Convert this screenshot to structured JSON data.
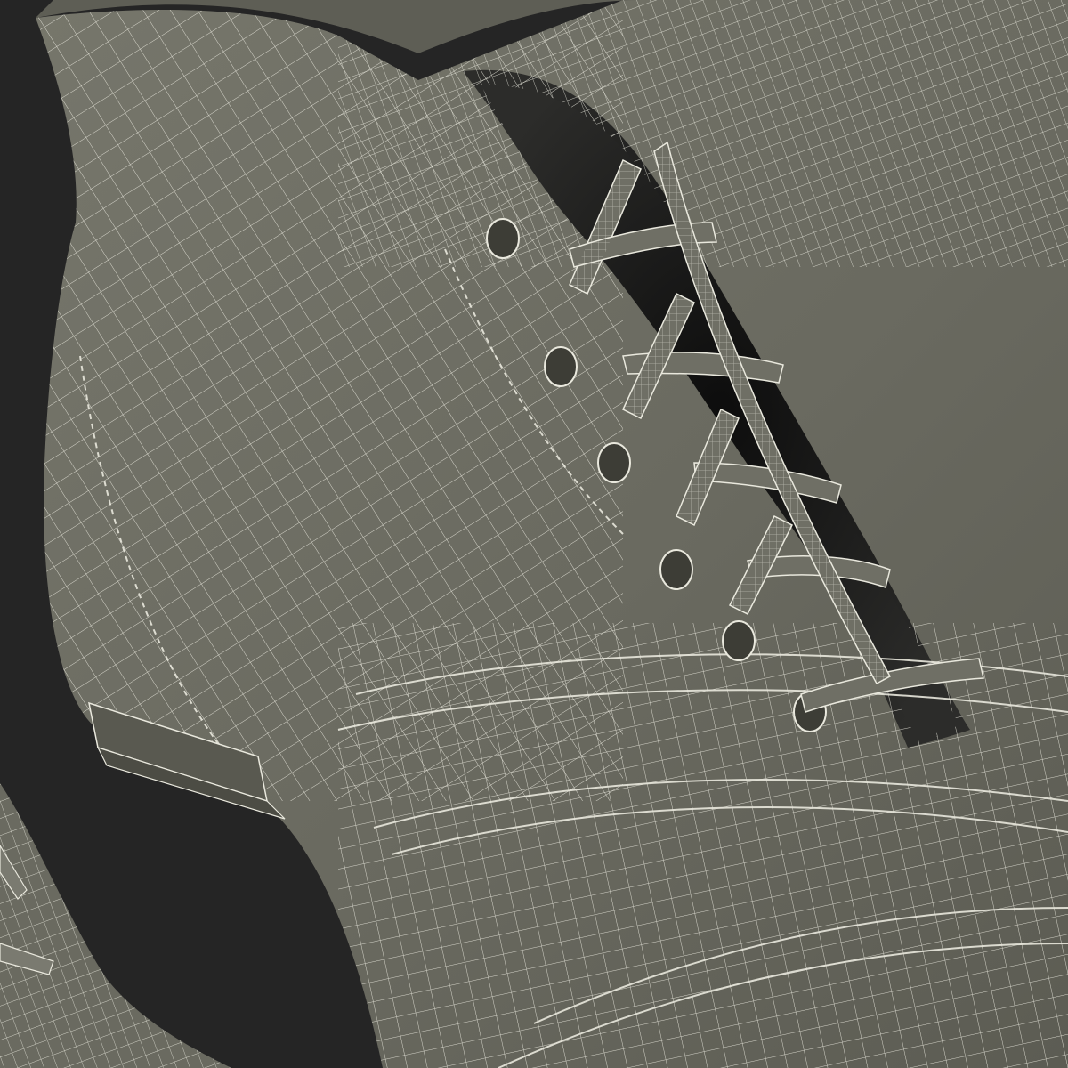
{
  "scene": {
    "subject": "wireframe-boot-render",
    "colors": {
      "background": "#252525",
      "shell": "#6e6e64",
      "shell_dark": "#55554c",
      "shell_light": "#7f7f74",
      "wire": "#e9e8dd",
      "interior": "#1a1a1a"
    }
  }
}
